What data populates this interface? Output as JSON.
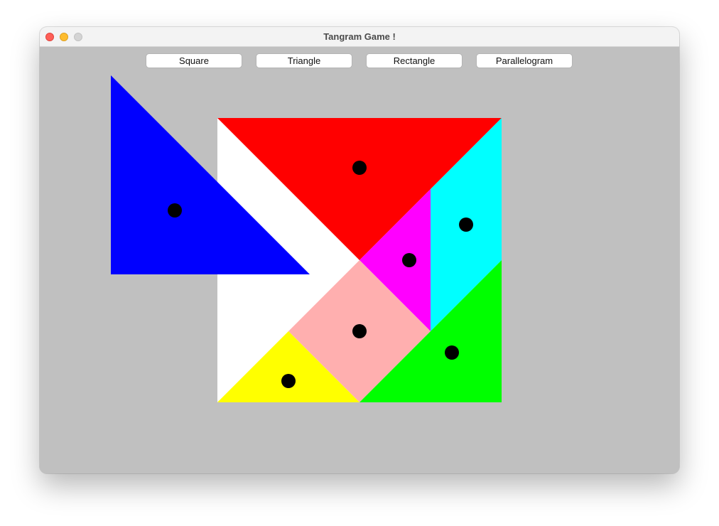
{
  "window": {
    "title": "Tangram Game !"
  },
  "toolbar": {
    "buttons": [
      {
        "label": "Square"
      },
      {
        "label": "Triangle"
      },
      {
        "label": "Rectangle"
      },
      {
        "label": "Parallelogram"
      }
    ]
  },
  "board": {
    "background": "#c0c0c0",
    "piece_colors": {
      "blue": "#0000ff",
      "red": "#ff0000",
      "cyan": "#00ffff",
      "magenta": "#ff00ff",
      "pink": "#ffafaf",
      "green": "#00ff00",
      "yellow": "#ffff00",
      "white": "#ffffff"
    },
    "handle_color": "#000000"
  }
}
